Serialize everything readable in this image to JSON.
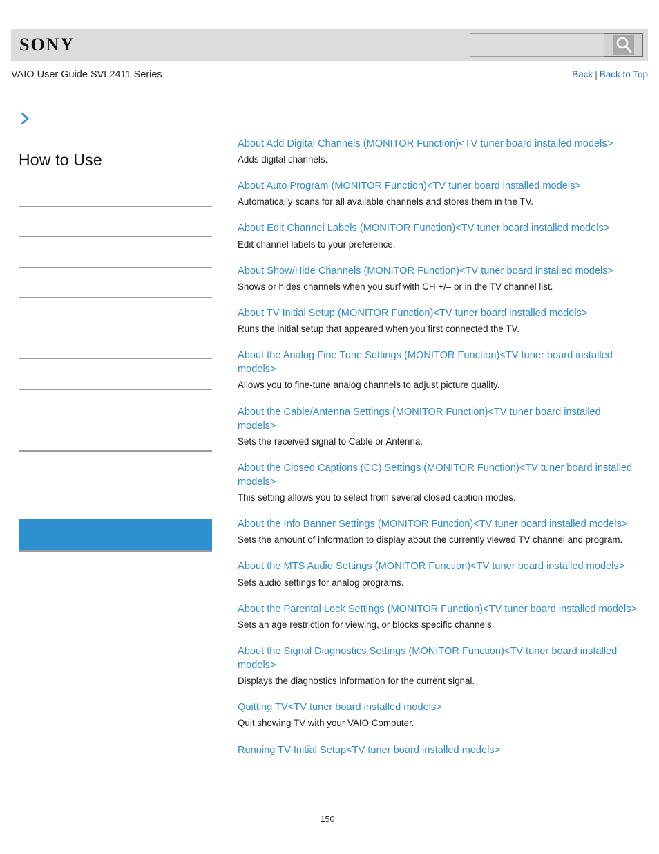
{
  "header": {
    "logo_text": "SONY",
    "search": {
      "value": "",
      "placeholder": "",
      "icon": "search-icon",
      "button_label": ""
    }
  },
  "breadcrumb": {
    "guide_title": "VAIO User Guide SVL2411 Series",
    "back_label": "Back",
    "separator": "|",
    "back_to_top_label": "Back to Top"
  },
  "sidebar": {
    "arrow_icon": "chevron-right-icon",
    "title": "How to Use",
    "accent_color": "#2e90cf",
    "rule_color": "#9a9a9a",
    "items": [
      {
        "label": "",
        "selected": false
      },
      {
        "label": "",
        "selected": false
      },
      {
        "label": "",
        "selected": false
      },
      {
        "label": "",
        "selected": false
      },
      {
        "label": "",
        "selected": false
      },
      {
        "label": "",
        "selected": false
      },
      {
        "label": "",
        "selected": false
      },
      {
        "label": "",
        "selected": false
      },
      {
        "label": "",
        "selected": false
      },
      {
        "label": "",
        "selected": false
      },
      {
        "label": "",
        "selected": true
      }
    ]
  },
  "main": {
    "link_color": "#2e8ad0",
    "entries": [
      {
        "title": "About Add Digital Channels (MONITOR Function)<TV tuner board installed models>",
        "description": "Adds digital channels."
      },
      {
        "title": "About Auto Program (MONITOR Function)<TV tuner board installed models>",
        "description": "Automatically scans for all available channels and stores them in the TV."
      },
      {
        "title": "About Edit Channel Labels (MONITOR Function)<TV tuner board installed models>",
        "description": "Edit channel labels to your preference."
      },
      {
        "title": "About Show/Hide Channels (MONITOR Function)<TV tuner board installed models>",
        "description": "Shows or hides channels when you surf with CH +/– or in the TV channel list."
      },
      {
        "title": "About TV Initial Setup (MONITOR Function)<TV tuner board installed models>",
        "description": "Runs the initial setup that appeared when you first connected the TV."
      },
      {
        "title": "About the Analog Fine Tune Settings (MONITOR Function)<TV tuner board installed models>",
        "description": "Allows you to fine-tune analog channels to adjust picture quality."
      },
      {
        "title": "About the Cable/Antenna Settings (MONITOR Function)<TV tuner board installed models>",
        "description": "Sets the received signal to Cable or Antenna."
      },
      {
        "title": "About the Closed Captions (CC) Settings (MONITOR Function)<TV tuner board installed models>",
        "description": "This setting allows you to select from several closed caption modes."
      },
      {
        "title": "About the Info Banner Settings (MONITOR Function)<TV tuner board installed models>",
        "description": "Sets the amount of information to display about the currently viewed TV channel and program."
      },
      {
        "title": "About the MTS Audio Settings (MONITOR Function)<TV tuner board installed models>",
        "description": "Sets audio settings for analog programs."
      },
      {
        "title": "About the Parental Lock Settings (MONITOR Function)<TV tuner board installed models>",
        "description": "Sets an age restriction for viewing, or blocks specific channels."
      },
      {
        "title": "About the Signal Diagnostics Settings (MONITOR Function)<TV tuner board installed models>",
        "description": "Displays the diagnostics information for the current signal."
      },
      {
        "title": "Quitting TV<TV tuner board installed models>",
        "description": "Quit showing TV with your VAIO Computer."
      },
      {
        "title": "Running TV Initial Setup<TV tuner board installed models>",
        "description": ""
      }
    ]
  },
  "footer": {
    "page_number": "150"
  }
}
